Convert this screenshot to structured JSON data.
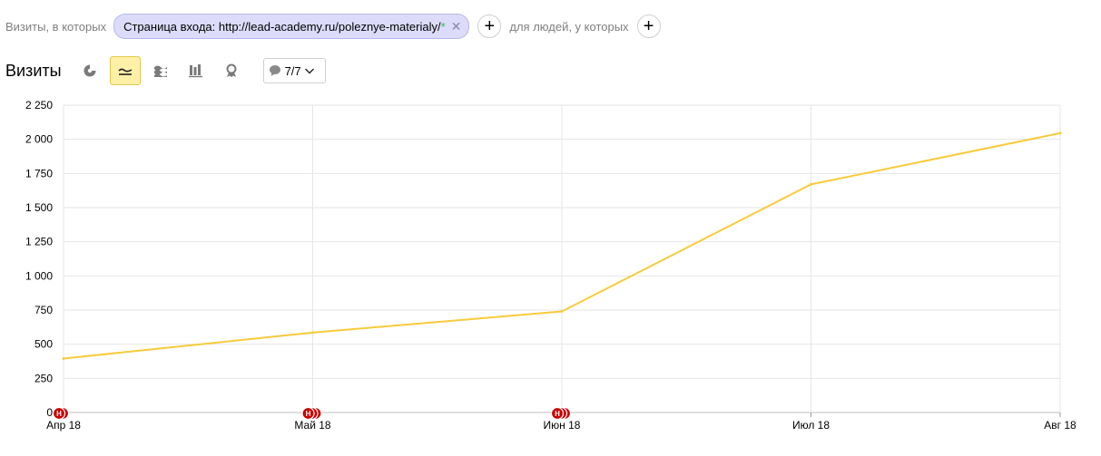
{
  "filter": {
    "prefix_label": "Визиты, в которых",
    "chip_label": "Страница входа: http://lead-academy.ru/poleznye-materialy/",
    "chip_star": "*",
    "add_label": "+",
    "people_label": "для людей, у которых"
  },
  "toolbar": {
    "title": "Визиты",
    "view_icons": [
      "pie-chart-icon",
      "line-chart-icon",
      "area-chart-icon",
      "bar-chart-icon",
      "map-icon"
    ],
    "active_view": "line-chart-icon",
    "notes_count": "7/7"
  },
  "colors": {
    "line": "#f7cb3b",
    "marker": "#cc0000",
    "grid": "#e6e6e6",
    "active_bg": "#fff0a8"
  },
  "chart_data": {
    "type": "line",
    "categories": [
      "Апр 18",
      "Май 18",
      "Июн 18",
      "Июл 18",
      "Авг 18"
    ],
    "series": [
      {
        "values": [
          395,
          585,
          740,
          1670,
          2045
        ]
      }
    ],
    "ylim": [
      0,
      2250
    ],
    "yticks": [
      0,
      250,
      500,
      750,
      1000,
      1250,
      1500,
      1750,
      2000,
      2250
    ],
    "ytick_labels": [
      "0",
      "250",
      "500",
      "750",
      "1 000",
      "1 250",
      "1 500",
      "1 750",
      "2 000",
      "2 250"
    ],
    "grid": true,
    "markers": [
      {
        "category": "Апр 18",
        "count": 2,
        "label": "Н"
      },
      {
        "category": "Май 18",
        "count": 3,
        "label": "Н"
      },
      {
        "category": "Июн 18",
        "count": 3,
        "label": "Н"
      }
    ]
  }
}
